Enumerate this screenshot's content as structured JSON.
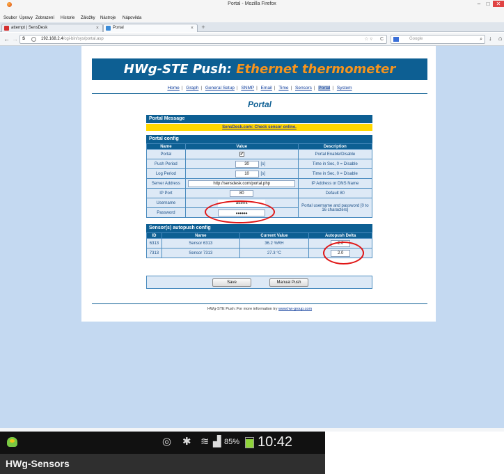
{
  "window": {
    "title": "Portal - Mozilla Firefox",
    "min": "–",
    "max": "□",
    "close": "✕"
  },
  "menu": {
    "items": [
      "Soubor",
      "Úpravy",
      "Zobrazení",
      "Historie",
      "Záložky",
      "Nástroje",
      "Nápověda"
    ]
  },
  "tabs": {
    "items": [
      "attempt | SensDesk",
      "Portal"
    ],
    "close": "×",
    "new": "+"
  },
  "navbar": {
    "back": "←",
    "forward": "→",
    "s_glyph": "S",
    "url_host": "192.168.2.4",
    "url_path": "/cgi-bin/sys/portal.asp",
    "star": "☆ ▿",
    "reload": "C",
    "search_placeholder": "Google",
    "search_glyph": "⌕",
    "download_glyph": "↓",
    "home_glyph": "⌂"
  },
  "banner": {
    "main": "HWg-STE Push:",
    "sub": "Ethernet thermometer"
  },
  "nav_links": [
    "Home",
    "Graph",
    "General Setup",
    "SNMP",
    "Email",
    "Time",
    "Sensors",
    "Portal",
    "System"
  ],
  "nav_sep": "|",
  "page_title": "Portal",
  "portal_message": {
    "header": "Portal Message",
    "text": "SensDesk.com: Check sensor online."
  },
  "portal_config": {
    "header": "Portal config",
    "columns": [
      "Name",
      "Value",
      "Description"
    ],
    "rows": {
      "portal": {
        "name": "Portal",
        "value": "✔",
        "desc": "Portal Enable/Disable"
      },
      "push_period": {
        "name": "Push Period",
        "value": "30",
        "unit": "[s]",
        "desc": "Time in Sec, 0 = Disable"
      },
      "log_period": {
        "name": "Log Period",
        "value": "10",
        "unit": "[s]",
        "desc": "Time in Sec, 0 = Disable"
      },
      "server_address": {
        "name": "Server Address",
        "value": "http://sensdesk.com/portal.php",
        "desc": "IP Address or DNS Name"
      },
      "ip_port": {
        "name": "IP Port",
        "value": "80",
        "desc": "Default 80"
      },
      "username": {
        "name": "Username",
        "value": "attemt"
      },
      "password": {
        "name": "Password",
        "value": "••••••"
      },
      "credentials_desc": "Portal username and password [0 to 16 characters]"
    }
  },
  "sensors": {
    "header": "Sensor(s) autopush config",
    "columns": [
      "ID",
      "Name",
      "Current Value",
      "Autopush Delta"
    ],
    "rows": [
      {
        "id": "6313",
        "name": "Sensor 6313",
        "value": "36.2 %RH",
        "delta": "2.0"
      },
      {
        "id": "7313",
        "name": "Sensor 7313",
        "value": "27.3 °C",
        "delta": "2.0"
      }
    ]
  },
  "buttons": {
    "save": "Save",
    "manual_push": "Manual Push"
  },
  "footer": {
    "text": "HWg-STE Push :For more information try",
    "link": "www.hw-group.com"
  },
  "android": {
    "eye_glyph": "◎",
    "bt_glyph": "✱",
    "wifi_glyph": "≋",
    "signal_glyph": "▟",
    "battery": "85%",
    "time": "10:42",
    "app_title": "HWg-Sensors"
  }
}
